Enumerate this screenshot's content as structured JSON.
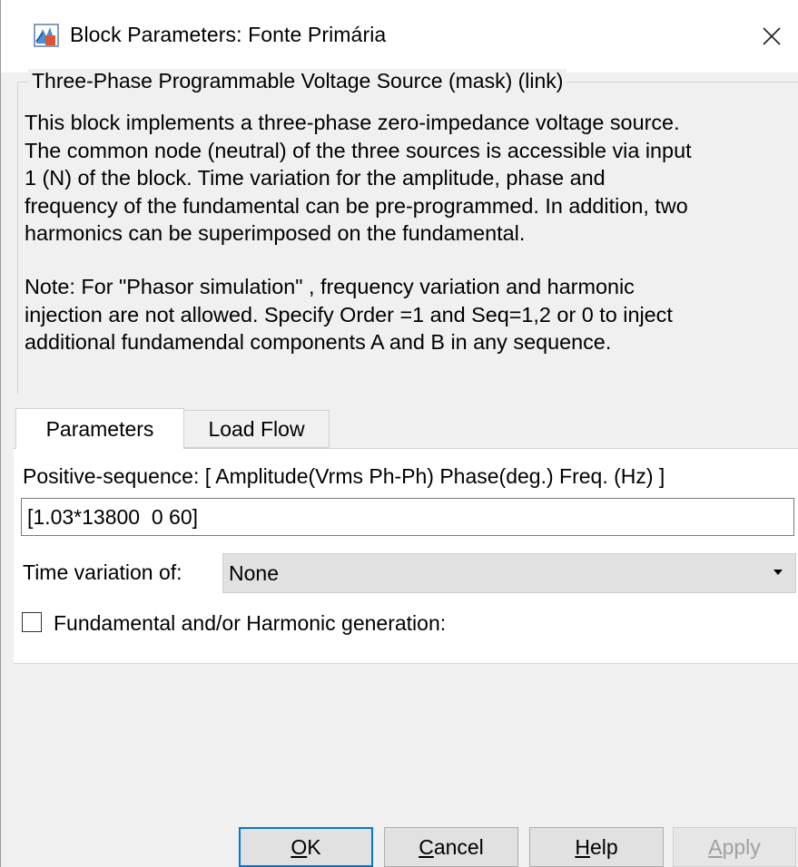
{
  "window": {
    "title": "Block Parameters: Fonte Primária",
    "icon": "simulink-block-icon",
    "close_icon": "close-icon"
  },
  "group": {
    "title": "Three-Phase Programmable Voltage Source (mask) (link)",
    "description_lines": [
      "This block implements a three-phase zero-impedance voltage source.",
      "The common node (neutral) of the three sources is accessible via input",
      "1 (N) of the block. Time variation for the amplitude, phase and",
      "frequency of the fundamental can be pre-programmed. In addition, two",
      "harmonics can be superimposed on the fundamental."
    ],
    "note_lines": [
      "Note: For  \"Phasor simulation\" , frequency variation and harmonic",
      "injection are not allowed.  Specify  Order =1 and Seq=1,2 or 0 to inject",
      "additional fundamendal components A and B in  any sequence."
    ]
  },
  "tabs": [
    {
      "label": "Parameters",
      "active": true
    },
    {
      "label": "Load Flow",
      "active": false
    }
  ],
  "parameters": {
    "positive_sequence_label": "Positive-sequence: [ Amplitude(Vrms Ph-Ph)  Phase(deg.)   Freq. (Hz) ]",
    "positive_sequence_value": "[1.03*13800  0 60]",
    "time_variation_label": "Time variation of:",
    "time_variation_value": "None",
    "harmonic_label": "Fundamental and/or Harmonic generation:",
    "harmonic_checked": false
  },
  "buttons": {
    "ok_mnemonic": "O",
    "ok_rest": "K",
    "cancel_mnemonic": "C",
    "cancel_rest": "ancel",
    "help_mnemonic": "H",
    "help_rest": "elp",
    "apply_mnemonic": "A",
    "apply_rest": "pply",
    "apply_enabled": false
  }
}
